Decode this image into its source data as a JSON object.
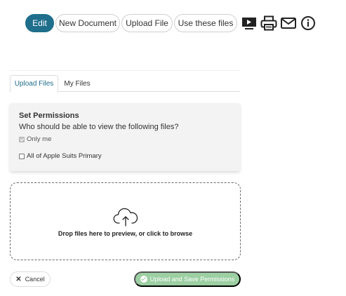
{
  "toolbar": {
    "edit_label": "Edit",
    "new_document_label": "New Document",
    "upload_file_label": "Upload File",
    "use_files_label": "Use these files",
    "icons": [
      "video-icon",
      "print-icon",
      "mail-icon",
      "info-icon"
    ]
  },
  "tabs": [
    {
      "label": "Upload Files",
      "active": true
    },
    {
      "label": "My Files",
      "active": false
    }
  ],
  "permissions": {
    "title": "Set Permissions",
    "question": "Who should be able to view the following files?",
    "options": [
      {
        "label": "Only me",
        "checked": true,
        "disabled": true
      },
      {
        "label": "All of Apple Suits Primary",
        "checked": false,
        "disabled": false
      }
    ]
  },
  "dropzone": {
    "text": "Drop files here to preview, or click to browse",
    "icon": "cloud-upload-icon"
  },
  "actions": {
    "cancel_label": "Cancel",
    "upload_label": "Upload and Save Permissions"
  },
  "colors": {
    "primary": "#1f6e8c",
    "success": "#9ccfa2"
  }
}
